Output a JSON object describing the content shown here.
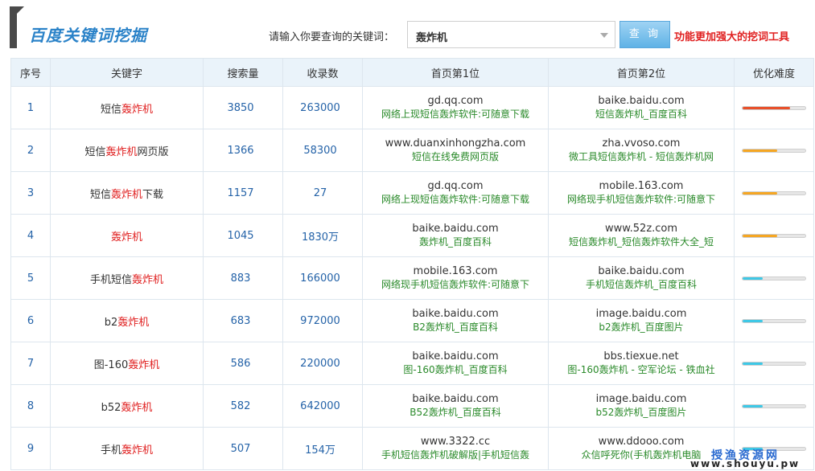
{
  "header": {
    "title": "百度关键词挖掘",
    "prompt_label": "请输入你要查询的关键词：",
    "keyword_value": "轰炸机",
    "query_button": "查 询",
    "promo_link": "功能更加强大的挖词工具"
  },
  "table": {
    "columns": [
      "序号",
      "关键字",
      "搜索量",
      "收录数",
      "首页第1位",
      "首页第2位",
      "优化难度"
    ],
    "rows": [
      {
        "idx": "1",
        "kw_pre": "短信",
        "kw_hl": "轰炸机",
        "kw_post": "",
        "volume": "3850",
        "indexed": "263000",
        "first_domain": "gd.qq.com",
        "first_title": "网络上现短信轰炸软件:可随意下载",
        "second_domain": "baike.baidu.com",
        "second_title": "短信轰炸机_百度百科",
        "difficulty": 0.75,
        "difficulty_color": "#e8502a"
      },
      {
        "idx": "2",
        "kw_pre": "短信",
        "kw_hl": "轰炸机",
        "kw_post": "网页版",
        "volume": "1366",
        "indexed": "58300",
        "first_domain": "www.duanxinhongzha.com",
        "first_title": "短信在线免费网页版",
        "second_domain": "zha.vvoso.com",
        "second_title": "微工具短信轰炸机 - 短信轰炸机网",
        "difficulty": 0.55,
        "difficulty_color": "#f5a623"
      },
      {
        "idx": "3",
        "kw_pre": "短信",
        "kw_hl": "轰炸机",
        "kw_post": "下载",
        "volume": "1157",
        "indexed": "27",
        "first_domain": "gd.qq.com",
        "first_title": "网络上现短信轰炸软件:可随意下载",
        "second_domain": "mobile.163.com",
        "second_title": "网络现手机短信轰炸软件:可随意下",
        "difficulty": 0.55,
        "difficulty_color": "#f5a623"
      },
      {
        "idx": "4",
        "kw_pre": "",
        "kw_hl": "轰炸机",
        "kw_post": "",
        "volume": "1045",
        "indexed": "1830万",
        "first_domain": "baike.baidu.com",
        "first_title": "轰炸机_百度百科",
        "second_domain": "www.52z.com",
        "second_title": "短信轰炸机_短信轰炸软件大全_短",
        "difficulty": 0.55,
        "difficulty_color": "#f5a623"
      },
      {
        "idx": "5",
        "kw_pre": "手机短信",
        "kw_hl": "轰炸机",
        "kw_post": "",
        "volume": "883",
        "indexed": "166000",
        "first_domain": "mobile.163.com",
        "first_title": "网络现手机短信轰炸软件:可随意下",
        "second_domain": "baike.baidu.com",
        "second_title": "手机短信轰炸机_百度百科",
        "difficulty": 0.32,
        "difficulty_color": "#3ec8e6"
      },
      {
        "idx": "6",
        "kw_pre": "b2",
        "kw_hl": "轰炸机",
        "kw_post": "",
        "volume": "683",
        "indexed": "972000",
        "first_domain": "baike.baidu.com",
        "first_title": "B2轰炸机_百度百科",
        "second_domain": "image.baidu.com",
        "second_title": "b2轰炸机_百度图片",
        "difficulty": 0.32,
        "difficulty_color": "#3ec8e6"
      },
      {
        "idx": "7",
        "kw_pre": "图-160",
        "kw_hl": "轰炸机",
        "kw_post": "",
        "volume": "586",
        "indexed": "220000",
        "first_domain": "baike.baidu.com",
        "first_title": "图-160轰炸机_百度百科",
        "second_domain": "bbs.tiexue.net",
        "second_title": "图-160轰炸机 - 空军论坛 - 铁血社",
        "difficulty": 0.32,
        "difficulty_color": "#3ec8e6"
      },
      {
        "idx": "8",
        "kw_pre": "b52",
        "kw_hl": "轰炸机",
        "kw_post": "",
        "volume": "582",
        "indexed": "642000",
        "first_domain": "baike.baidu.com",
        "first_title": "B52轰炸机_百度百科",
        "second_domain": "image.baidu.com",
        "second_title": "b52轰炸机_百度图片",
        "difficulty": 0.32,
        "difficulty_color": "#3ec8e6"
      },
      {
        "idx": "9",
        "kw_pre": "手机",
        "kw_hl": "轰炸机",
        "kw_post": "",
        "volume": "507",
        "indexed": "154万",
        "first_domain": "www.3322.cc",
        "first_title": "手机短信轰炸机破解版|手机短信轰",
        "second_domain": "www.ddooo.com",
        "second_title": "众信呼死你(手机轰炸机电脑",
        "difficulty": 0.32,
        "difficulty_color": "#3ec8e6"
      }
    ]
  },
  "watermark": {
    "line1": "授渔资源网",
    "line2": "www.shouyu.pw"
  }
}
